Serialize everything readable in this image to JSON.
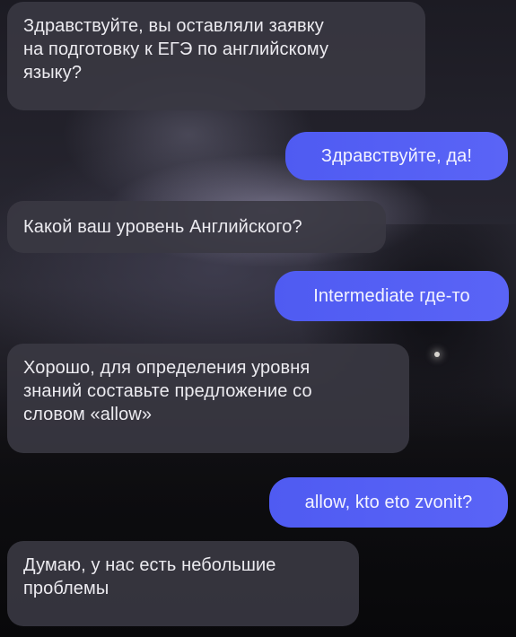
{
  "chat": {
    "messages": [
      {
        "direction": "incoming",
        "text": "Здравствуйте, вы оставляли заявку\nна подготовку к ЕГЭ по английскому\nязыку?"
      },
      {
        "direction": "outgoing",
        "text": "Здравствуйте, да!"
      },
      {
        "direction": "incoming",
        "text": "Какой ваш уровень Английского?"
      },
      {
        "direction": "outgoing",
        "text": "Intermediate где-то"
      },
      {
        "direction": "incoming",
        "text": "Хорошо, для определения уровня\nзнаний составьте предложение со\nсловом «allow»"
      },
      {
        "direction": "outgoing",
        "text": "allow, kto eto zvonit?"
      },
      {
        "direction": "incoming",
        "text": "Думаю, у нас есть небольшие\nпроблемы"
      }
    ]
  },
  "colors": {
    "incoming_bubble": "#3a3842",
    "outgoing_bubble": "#5560f4",
    "text_light": "#ecebf0"
  }
}
